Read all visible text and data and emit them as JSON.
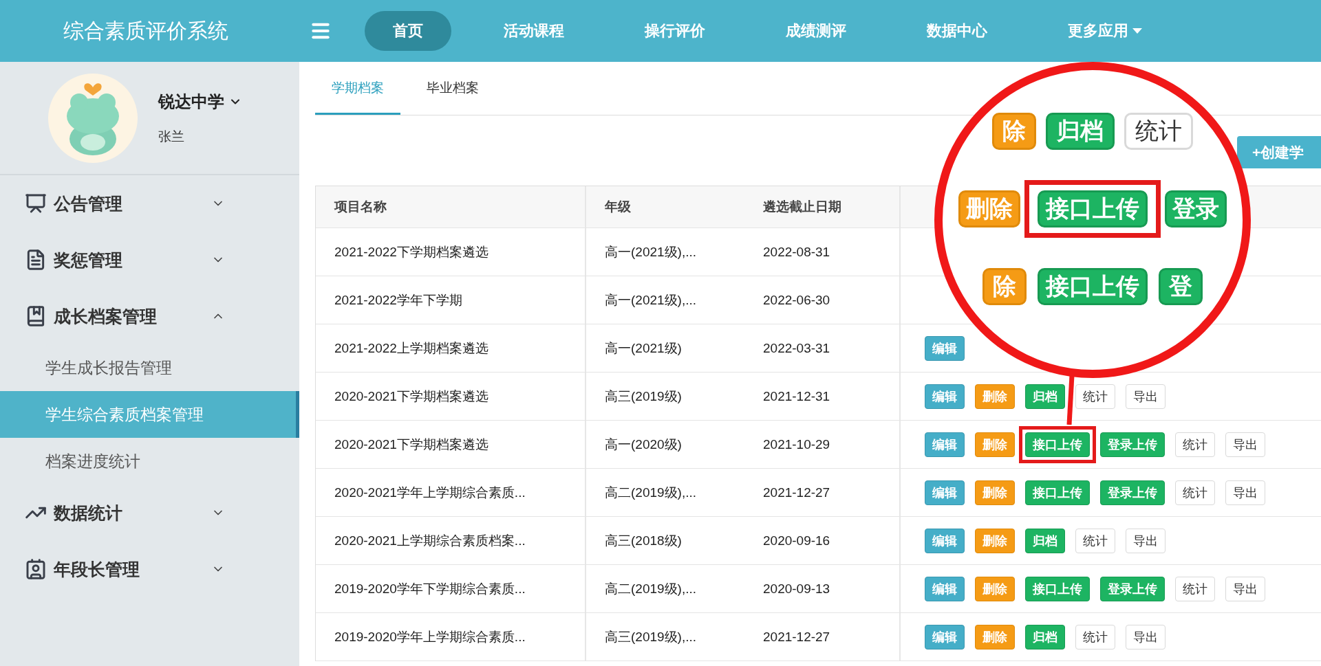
{
  "app": {
    "title": "综合素质评价系统"
  },
  "nav": [
    {
      "label": "首页",
      "selected": true,
      "dropdown": false
    },
    {
      "label": "活动课程",
      "selected": false,
      "dropdown": false
    },
    {
      "label": "操行评价",
      "selected": false,
      "dropdown": false
    },
    {
      "label": "成绩测评",
      "selected": false,
      "dropdown": false
    },
    {
      "label": "数据中心",
      "selected": false,
      "dropdown": false
    },
    {
      "label": "更多应用",
      "selected": false,
      "dropdown": true
    }
  ],
  "profile": {
    "school": "锐达中学",
    "name": "张兰"
  },
  "sidebar": {
    "items": [
      {
        "label": "公告管理",
        "expanded": false
      },
      {
        "label": "奖惩管理",
        "expanded": false
      },
      {
        "label": "成长档案管理",
        "expanded": true,
        "children": [
          {
            "label": "学生成长报告管理",
            "selected": false
          },
          {
            "label": "学生综合素质档案管理",
            "selected": true
          },
          {
            "label": "档案进度统计",
            "selected": false
          }
        ]
      },
      {
        "label": "数据统计",
        "expanded": false
      },
      {
        "label": "年段长管理",
        "expanded": false
      }
    ]
  },
  "tabs": [
    {
      "label": "学期档案",
      "selected": true
    },
    {
      "label": "毕业档案",
      "selected": false
    }
  ],
  "create_button": {
    "label": "+创建学"
  },
  "table": {
    "columns": [
      "项目名称",
      "年级",
      "遴选截止日期"
    ],
    "rows": [
      {
        "cells": [
          "2021-2022下学期档案遴选",
          "高一(2021级),...",
          "2022-08-31"
        ]
      },
      {
        "cells": [
          "2021-2022学年下学期",
          "高一(2021级),...",
          "2022-06-30"
        ]
      },
      {
        "cells": [
          "2021-2022上学期档案遴选",
          "高一(2021级)",
          "2022-03-31"
        ],
        "actions": [
          {
            "label": "编辑",
            "kind": "edit",
            "highlighted": false
          }
        ]
      },
      {
        "cells": [
          "2020-2021下学期档案遴选",
          "高三(2019级)",
          "2021-12-31"
        ],
        "actions": [
          {
            "label": "编辑",
            "kind": "edit",
            "highlighted": false
          },
          {
            "label": "删除",
            "kind": "danger",
            "highlighted": false
          },
          {
            "label": "归档",
            "kind": "success",
            "highlighted": false
          },
          {
            "label": "统计",
            "kind": "plain",
            "highlighted": false
          },
          {
            "label": "导出",
            "kind": "plain",
            "highlighted": false
          }
        ]
      },
      {
        "cells": [
          "2020-2021下学期档案遴选",
          "高一(2020级)",
          "2021-10-29"
        ],
        "actions": [
          {
            "label": "编辑",
            "kind": "edit",
            "highlighted": false
          },
          {
            "label": "删除",
            "kind": "danger",
            "highlighted": false
          },
          {
            "label": "接口上传",
            "kind": "success",
            "highlighted": true
          },
          {
            "label": "登录上传",
            "kind": "success",
            "highlighted": false
          },
          {
            "label": "统计",
            "kind": "plain",
            "highlighted": false
          },
          {
            "label": "导出",
            "kind": "plain",
            "highlighted": false
          }
        ]
      },
      {
        "cells": [
          "2020-2021学年上学期综合素质...",
          "高二(2019级),...",
          "2021-12-27"
        ],
        "actions": [
          {
            "label": "编辑",
            "kind": "edit",
            "highlighted": false
          },
          {
            "label": "删除",
            "kind": "danger",
            "highlighted": false
          },
          {
            "label": "接口上传",
            "kind": "success",
            "highlighted": false
          },
          {
            "label": "登录上传",
            "kind": "success",
            "highlighted": false
          },
          {
            "label": "统计",
            "kind": "plain",
            "highlighted": false
          },
          {
            "label": "导出",
            "kind": "plain",
            "highlighted": false
          }
        ]
      },
      {
        "cells": [
          "2020-2021上学期综合素质档案...",
          "高三(2018级)",
          "2020-09-16"
        ],
        "actions": [
          {
            "label": "编辑",
            "kind": "edit",
            "highlighted": false
          },
          {
            "label": "删除",
            "kind": "danger",
            "highlighted": false
          },
          {
            "label": "归档",
            "kind": "success",
            "highlighted": false
          },
          {
            "label": "统计",
            "kind": "plain",
            "highlighted": false
          },
          {
            "label": "导出",
            "kind": "plain",
            "highlighted": false
          }
        ]
      },
      {
        "cells": [
          "2019-2020学年下学期综合素质...",
          "高二(2019级),...",
          "2020-09-13"
        ],
        "actions": [
          {
            "label": "编辑",
            "kind": "edit",
            "highlighted": false
          },
          {
            "label": "删除",
            "kind": "danger",
            "highlighted": false
          },
          {
            "label": "接口上传",
            "kind": "success",
            "highlighted": false
          },
          {
            "label": "登录上传",
            "kind": "success",
            "highlighted": false
          },
          {
            "label": "统计",
            "kind": "plain",
            "highlighted": false
          },
          {
            "label": "导出",
            "kind": "plain",
            "highlighted": false
          }
        ]
      },
      {
        "cells": [
          "2019-2020学年上学期综合素质...",
          "高三(2019级),...",
          "2021-12-27"
        ],
        "actions": [
          {
            "label": "编辑",
            "kind": "edit",
            "highlighted": false
          },
          {
            "label": "删除",
            "kind": "danger",
            "highlighted": false
          },
          {
            "label": "归档",
            "kind": "success",
            "highlighted": false
          },
          {
            "label": "统计",
            "kind": "plain",
            "highlighted": false
          },
          {
            "label": "导出",
            "kind": "plain",
            "highlighted": false
          }
        ]
      }
    ]
  },
  "magnifier": {
    "rows": [
      {
        "actions": [
          {
            "label": "除",
            "kind": "danger",
            "highlighted": false
          },
          {
            "label": "归档",
            "kind": "success",
            "highlighted": false
          },
          {
            "label": "统计",
            "kind": "plain",
            "highlighted": false
          }
        ]
      },
      {
        "actions": [
          {
            "label": "删除",
            "kind": "danger",
            "highlighted": false
          },
          {
            "label": "接口上传",
            "kind": "success",
            "highlighted": true
          },
          {
            "label": "登录",
            "kind": "success",
            "highlighted": false
          }
        ]
      },
      {
        "actions": [
          {
            "label": "除",
            "kind": "danger",
            "highlighted": false
          },
          {
            "label": "接口上传",
            "kind": "success",
            "highlighted": false
          },
          {
            "label": "登",
            "kind": "success",
            "highlighted": false
          }
        ]
      }
    ]
  }
}
